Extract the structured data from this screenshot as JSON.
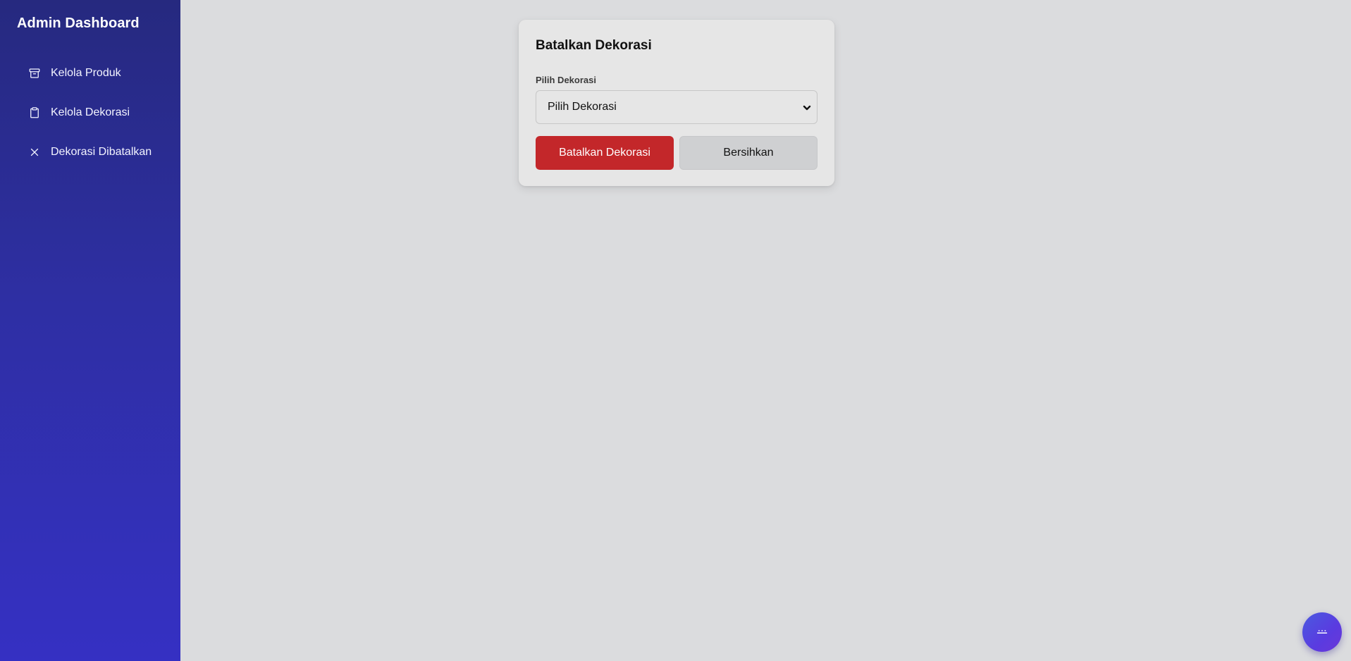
{
  "sidebar": {
    "title": "Admin Dashboard",
    "items": [
      {
        "label": "Kelola Produk",
        "icon": "archive-box-icon"
      },
      {
        "label": "Kelola Dekorasi",
        "icon": "clipboard-icon"
      },
      {
        "label": "Dekorasi Dibatalkan",
        "icon": "close-icon"
      }
    ]
  },
  "main": {
    "card": {
      "title": "Batalkan Dekorasi",
      "field_label": "Pilih Dekorasi",
      "select_value": "Pilih Dekorasi",
      "cancel_button_label": "Batalkan Dekorasi",
      "clear_button_label": "Bersihkan"
    }
  },
  "fab": {
    "icon": "chat-more-icon"
  },
  "colors": {
    "sidebar_top": "#26297f",
    "sidebar_bottom": "#3530c3",
    "danger": "#c3272a",
    "background": "#dbdcde"
  }
}
